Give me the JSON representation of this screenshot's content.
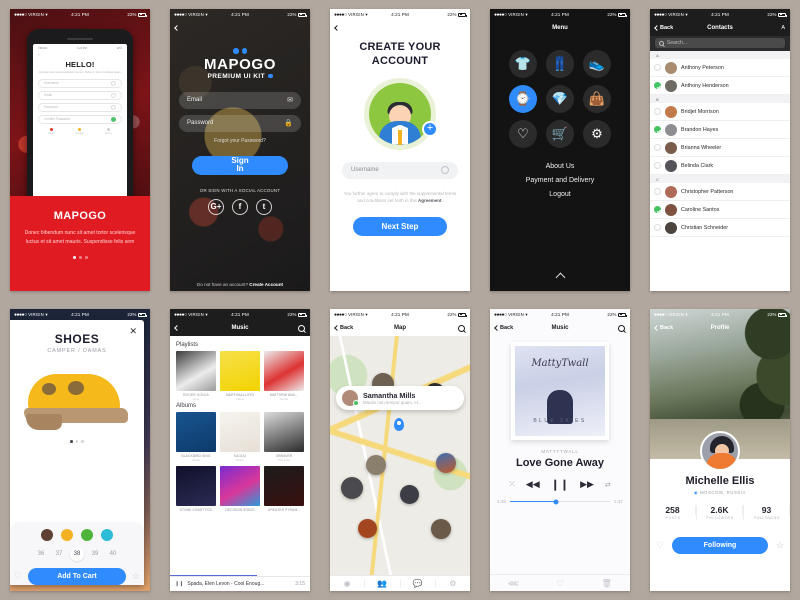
{
  "meta": {
    "background_color": "#b1a79e",
    "accent_color": "#2f8bff",
    "brand_red": "#e01b22"
  },
  "status_bar": {
    "carrier": "VIRGIN",
    "dots": "●●●●○",
    "wifi": "▾",
    "time": "4:21 PM",
    "battery": "22%"
  },
  "screen1": {
    "mock": {
      "back": "‹",
      "heading": "HELLO!",
      "paragraph": "Quisque justo turpis vestibulum tempor. Nulla mi. Sed sit volutpat quam.",
      "fields": [
        {
          "label": "Username"
        },
        {
          "label": "Email"
        },
        {
          "label": "Password"
        },
        {
          "label": "Confirm Password"
        }
      ],
      "meter": [
        {
          "label": "Weak",
          "color": "#e0352c"
        },
        {
          "label": "Average",
          "color": "#f4b223"
        },
        {
          "label": "Strong",
          "color": "#cfcfcf"
        }
      ]
    },
    "title": "MAPOGO",
    "description": "Donec bibendum nunc sit amet tortor scelerisque luctus et sit amet mauris. Suspendisse felis sem",
    "pager": {
      "count": 3,
      "active": 0
    }
  },
  "screen2": {
    "back": "‹",
    "logo": "MAPOGO",
    "tagline": "PREMIUM UI KIT",
    "fields": [
      {
        "placeholder": "Email",
        "icon": "✉",
        "icon_name": "mail-icon"
      },
      {
        "placeholder": "Password",
        "icon": "🔒",
        "icon_name": "lock-icon"
      }
    ],
    "forgot": "Forgot your Password?",
    "signin_line1": "Sign",
    "signin_line2": "In",
    "or_text": "OR SIGN WITH A SOCIAL ACCOUNT",
    "social": [
      {
        "label": "G+",
        "name": "google-plus-icon"
      },
      {
        "label": "f",
        "name": "facebook-icon"
      },
      {
        "label": "t",
        "name": "twitter-icon"
      }
    ],
    "footer_text": "Do not have an account?",
    "footer_link": "Create Account"
  },
  "screen3": {
    "back": "‹",
    "title_line1": "CREATE YOUR",
    "title_line2": "ACCOUNT",
    "plus": "+",
    "username_placeholder": "Username",
    "terms_a": "You further agree to comply with the supplemental terms and conditions set forth in this",
    "terms_b": "Agreement",
    "terms_end": ".",
    "next_button": "Next Step"
  },
  "screen4": {
    "title": "Menu",
    "tiles": [
      {
        "name": "shirt-icon",
        "glyph": "👕",
        "active": false
      },
      {
        "name": "pants-icon",
        "glyph": "👖",
        "active": false
      },
      {
        "name": "shoe-icon",
        "glyph": "👟",
        "active": false
      },
      {
        "name": "watch-icon",
        "glyph": "⌚",
        "active": true
      },
      {
        "name": "necklace-icon",
        "glyph": "💎",
        "active": false
      },
      {
        "name": "bag-icon",
        "glyph": "👜",
        "active": false
      },
      {
        "name": "heart-icon",
        "glyph": "♡",
        "active": false
      },
      {
        "name": "cart-icon",
        "glyph": "🛒",
        "active": false
      },
      {
        "name": "gear-icon",
        "glyph": "⚙",
        "active": false
      }
    ],
    "links": [
      "About Us",
      "Payment and Delivery",
      "Logout"
    ],
    "collapse": "^"
  },
  "screen5": {
    "back": "Back",
    "title": "Contacts",
    "action": "A",
    "search_placeholder": "Search...",
    "sections": [
      {
        "letter": "A",
        "rows": [
          {
            "name": "Anthony Peterson",
            "checked": false,
            "avatar": "#a98b6f"
          },
          {
            "name": "Anthony Henderson",
            "checked": true,
            "avatar": "#6f6a64"
          }
        ]
      },
      {
        "letter": "B",
        "rows": [
          {
            "name": "Bridjet Morrison",
            "checked": false,
            "avatar": "#c27a4a"
          },
          {
            "name": "Brandon Hayes",
            "checked": true,
            "avatar": "#8e8e92"
          },
          {
            "name": "Brianna Wheeler",
            "checked": false,
            "avatar": "#7a5c4a"
          },
          {
            "name": "Belinda Clark",
            "checked": false,
            "avatar": "#56525a"
          }
        ]
      },
      {
        "letter": "C",
        "rows": [
          {
            "name": "Christopher Patterson",
            "checked": false,
            "avatar": "#b06a58"
          },
          {
            "name": "Caroline Santos",
            "checked": true,
            "avatar": "#7e5140"
          },
          {
            "name": "Christian Schneider",
            "checked": false,
            "avatar": "#4c443e"
          }
        ]
      }
    ]
  },
  "screen6": {
    "close": "✕",
    "title": "SHOES",
    "subtitle": "CAMPER / DAMAS",
    "pager": {
      "count": 3,
      "active": 0
    },
    "colors": [
      "#5d4033",
      "#f4b223",
      "#4fb53a",
      "#2cbcd8"
    ],
    "sizes": [
      "36",
      "37",
      "38",
      "39",
      "40"
    ],
    "selected_size": "38",
    "add_to_cart": "Add To Cart",
    "heart": "♡",
    "star": "☆"
  },
  "screen7": {
    "back": "‹",
    "title": "Music",
    "search_icon": "search-icon",
    "sections": [
      {
        "heading": "Playlists",
        "items": [
          {
            "title": "ROGER GOULA",
            "artist": "Ame",
            "art": "linear-gradient(150deg,#3b3b3b,#ececec 60%,#9a9a9a)"
          },
          {
            "title": "MARTHA&LLOYD",
            "artist": "Hexa",
            "art": "linear-gradient(160deg,#f7e04a,#f2d300)"
          },
          {
            "title": "MATTHEW AND...",
            "artist": "Tondo",
            "art": "linear-gradient(150deg,#e9e9e9,#d33 60%,#eee)"
          }
        ]
      },
      {
        "heading": "Albums",
        "items": [
          {
            "title": "BLACKBIRD SING",
            "artist": "Clara",
            "art": "linear-gradient(160deg,#18548f,#0d3b6b)"
          },
          {
            "title": "KAGUU",
            "artist": "Mono",
            "art": "linear-gradient(160deg,#f4f1ec,#e8e2da)"
          },
          {
            "title": "OBRAVER",
            "artist": "The Four",
            "art": "linear-gradient(160deg,#d9d9d9,#2b2b2b)"
          },
          {
            "title": "STONE COAST FOX",
            "artist": "",
            "art": "linear-gradient(160deg,#10102a,#2b2b55)"
          },
          {
            "title": "DECISION SPACE",
            "artist": "",
            "art": "linear-gradient(150deg,#7a2bd0,#d9379a 55%,#2b9ad9)"
          },
          {
            "title": "GREATER PYRAM...",
            "artist": "",
            "art": "linear-gradient(160deg,#1c1c1c,#3a1010)"
          }
        ]
      }
    ],
    "now_playing": {
      "pause": "❙❙",
      "track": "Spada, Elen Levon - Cool Enoug...",
      "duration": "3:15"
    }
  },
  "screen8": {
    "back": "Back",
    "title": "Map",
    "search_icon": "search-icon",
    "card": {
      "name": "Samantha Mills",
      "message": "Mauris non tempor quam, el..."
    },
    "bubbles": [
      {
        "x": 30,
        "y": 28,
        "size": 22,
        "color": "#6e6152"
      },
      {
        "x": 70,
        "y": 32,
        "size": 20,
        "color": "#2e2e2e"
      },
      {
        "x": 28,
        "y": 57,
        "size": 20,
        "color": "#8a7f6d"
      },
      {
        "x": 12,
        "y": 64,
        "size": 22,
        "color": "#4a4a4f"
      },
      {
        "x": 52,
        "y": 67,
        "size": 19,
        "color": "#3d3d46"
      },
      {
        "x": 78,
        "y": 56,
        "size": 20,
        "color": "#c25a2a"
      },
      {
        "x": 24,
        "y": 78,
        "size": 19,
        "color": "#a3451e"
      },
      {
        "x": 74,
        "y": 78,
        "size": 20,
        "color": "#6b5a48"
      }
    ],
    "tabs": [
      {
        "name": "location-icon",
        "glyph": "◉"
      },
      {
        "name": "friends-icon",
        "glyph": "👥"
      },
      {
        "name": "chat-icon",
        "glyph": "💬"
      },
      {
        "name": "gear-icon",
        "glyph": "⚙"
      }
    ]
  },
  "screen9": {
    "back": "Back",
    "title": "Music",
    "search_icon": "search-icon",
    "album_script": "MattyTwall",
    "album_sub": "BLUE SKIES",
    "artist": "MATTYTWALL",
    "track_title": "Love Gone Away",
    "controls": [
      {
        "name": "shuffle-icon",
        "glyph": "⤫",
        "size": "sm"
      },
      {
        "name": "previous-icon",
        "glyph": "◀◀",
        "size": "md"
      },
      {
        "name": "pause-icon",
        "glyph": "❙❙",
        "size": "lg"
      },
      {
        "name": "next-icon",
        "glyph": "▶▶",
        "size": "md"
      },
      {
        "name": "repeat-icon",
        "glyph": "⇄",
        "size": "sm"
      }
    ],
    "elapsed": "1:45",
    "remaining": "2:47",
    "progress_percent": 46,
    "tabs": [
      {
        "name": "share-icon",
        "glyph": "⋘"
      },
      {
        "name": "heart-icon",
        "glyph": "♡"
      },
      {
        "name": "trash-icon",
        "glyph": "🗑"
      }
    ]
  },
  "screen10": {
    "back": "Back",
    "title": "Profile",
    "name": "Michelle Ellis",
    "location": "MOSCOW, RUSSIA",
    "location_icon": "pin-icon",
    "stats": [
      {
        "value": "258",
        "label": "POSTS"
      },
      {
        "value": "2.6K",
        "label": "FOLLOWERS"
      },
      {
        "value": "93",
        "label": "FOLLOWING"
      }
    ],
    "follow_button": "Following",
    "heart": "♡",
    "star": "☆"
  }
}
